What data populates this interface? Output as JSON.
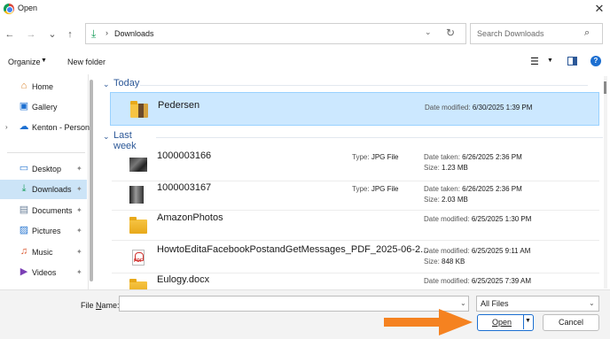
{
  "window": {
    "title": "Open",
    "close_icon": "close-icon"
  },
  "nav": {
    "back": "←",
    "forward": "→",
    "recent": "⌄",
    "up": "↑",
    "address": {
      "sep": "›",
      "location": "Downloads"
    },
    "search_placeholder": "Search Downloads"
  },
  "toolbar": {
    "organize": "Organize",
    "new_folder": "New folder"
  },
  "sidebar": {
    "items": [
      {
        "label": "Home",
        "icon": "home-icon"
      },
      {
        "label": "Gallery",
        "icon": "gallery-icon"
      },
      {
        "label": "Kenton - Person",
        "icon": "onedrive-icon"
      },
      {
        "label": "Desktop",
        "icon": "desktop-icon",
        "pinned": true
      },
      {
        "label": "Downloads",
        "icon": "download-icon",
        "pinned": true,
        "selected": true
      },
      {
        "label": "Documents",
        "icon": "documents-icon",
        "pinned": true
      },
      {
        "label": "Pictures",
        "icon": "pictures-icon",
        "pinned": true
      },
      {
        "label": "Music",
        "icon": "music-icon",
        "pinned": true
      },
      {
        "label": "Videos",
        "icon": "videos-icon",
        "pinned": true
      }
    ]
  },
  "groups": [
    {
      "title": "Today"
    },
    {
      "title": "Last week"
    }
  ],
  "files": [
    {
      "name": "Pedersen",
      "type": "",
      "date1_label": "Date modified:",
      "date1": "6/30/2025 1:39 PM",
      "size_label": "",
      "size": "",
      "selected": true
    },
    {
      "name": "1000003166",
      "type_label": "Type:",
      "type": "JPG File",
      "date1_label": "Date taken:",
      "date1": "6/26/2025 2:36 PM",
      "size_label": "Size:",
      "size": "1.23 MB"
    },
    {
      "name": "1000003167",
      "type_label": "Type:",
      "type": "JPG File",
      "date1_label": "Date taken:",
      "date1": "6/26/2025 2:36 PM",
      "size_label": "Size:",
      "size": "2.03 MB"
    },
    {
      "name": "AmazonPhotos",
      "type": "",
      "date1_label": "Date modified:",
      "date1": "6/25/2025 1:30 PM",
      "size_label": "",
      "size": ""
    },
    {
      "name": "HowtoEditaFacebookPostandGetMessages_PDF_2025-06-2...",
      "type": "",
      "date1_label": "Date modified:",
      "date1": "6/25/2025 9:11 AM",
      "size_label": "Size:",
      "size": "848 KB"
    },
    {
      "name": "Eulogy.docx",
      "type": "",
      "date1_label": "Date modified:",
      "date1": "6/25/2025 7:39 AM",
      "size_label": "",
      "size": ""
    }
  ],
  "bottom": {
    "file_name_label_u": "N",
    "file_name_label_a": "File ",
    "file_name_label_b": "ame:",
    "file_name_value": "",
    "file_type": "All Files",
    "open": "Open",
    "cancel": "Cancel"
  },
  "colors": {
    "accent": "#1c6fd1",
    "selection": "#cce8ff",
    "arrow": "#f58220"
  }
}
